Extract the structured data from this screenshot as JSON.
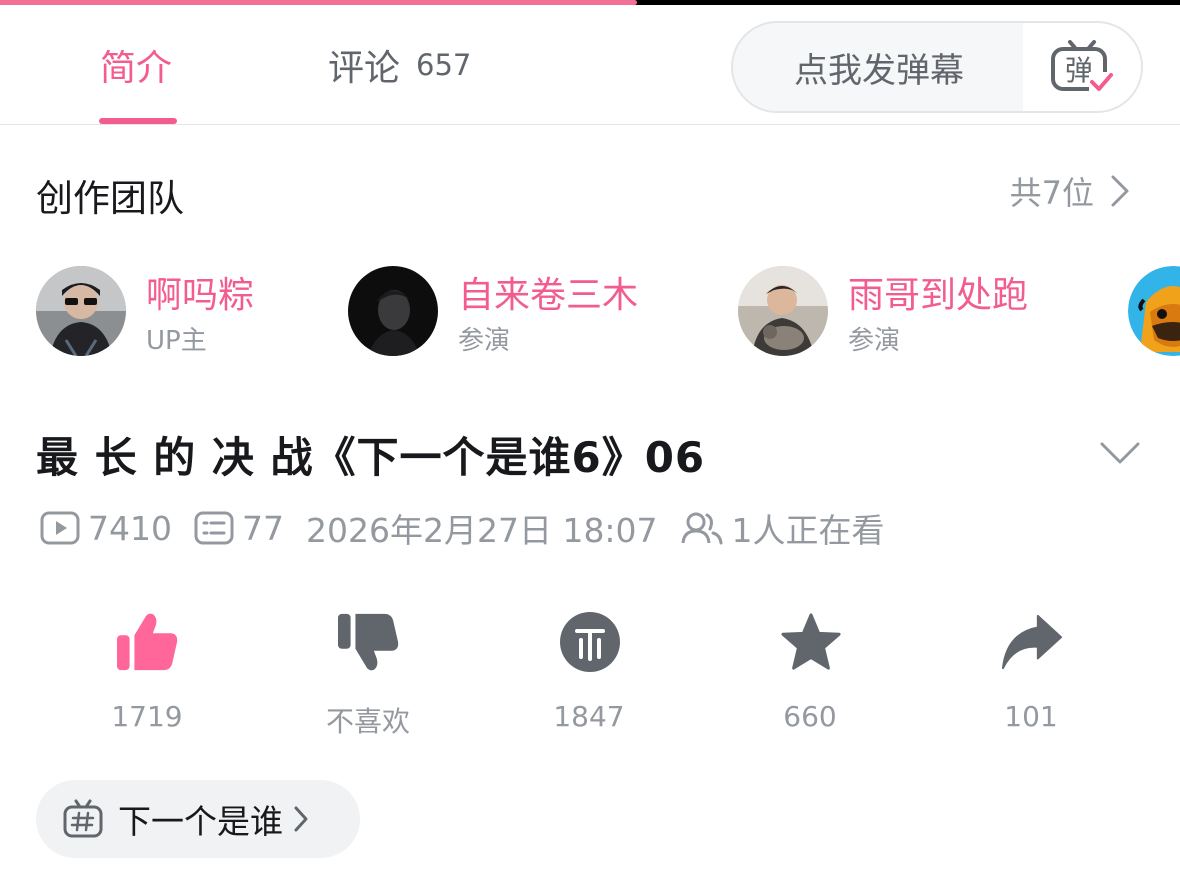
{
  "player": {
    "progress": 0.54
  },
  "tabs": {
    "intro_label": "简介",
    "comments_label": "评论",
    "comments_count": "657"
  },
  "danmaku": {
    "placeholder": "点我发弹幕",
    "button_glyph": "弹"
  },
  "team": {
    "title": "创作团队",
    "count_label": "共7位",
    "members": [
      {
        "name": "啊吗粽",
        "role": "UP主"
      },
      {
        "name": "自来卷三木",
        "role": "参演"
      },
      {
        "name": "雨哥到处跑",
        "role": "参演"
      }
    ]
  },
  "video": {
    "title": "最 长 的 决 战《下一个是谁6》06",
    "views": "7410",
    "danmaku_count": "77",
    "publish_time": "2026年2月27日 18:07",
    "watching": "1人正在看"
  },
  "actions": {
    "like": {
      "label": "1719",
      "active": true
    },
    "dislike": {
      "label": "不喜欢"
    },
    "coin": {
      "label": "1847"
    },
    "favorite": {
      "label": "660"
    },
    "share": {
      "label": "101"
    }
  },
  "topic": {
    "label": "下一个是谁"
  },
  "colors": {
    "accent_pink": "#f25d8e",
    "like_pink": "#ff6699",
    "icon_dark": "#61666d",
    "muted_text": "#9499a0"
  }
}
